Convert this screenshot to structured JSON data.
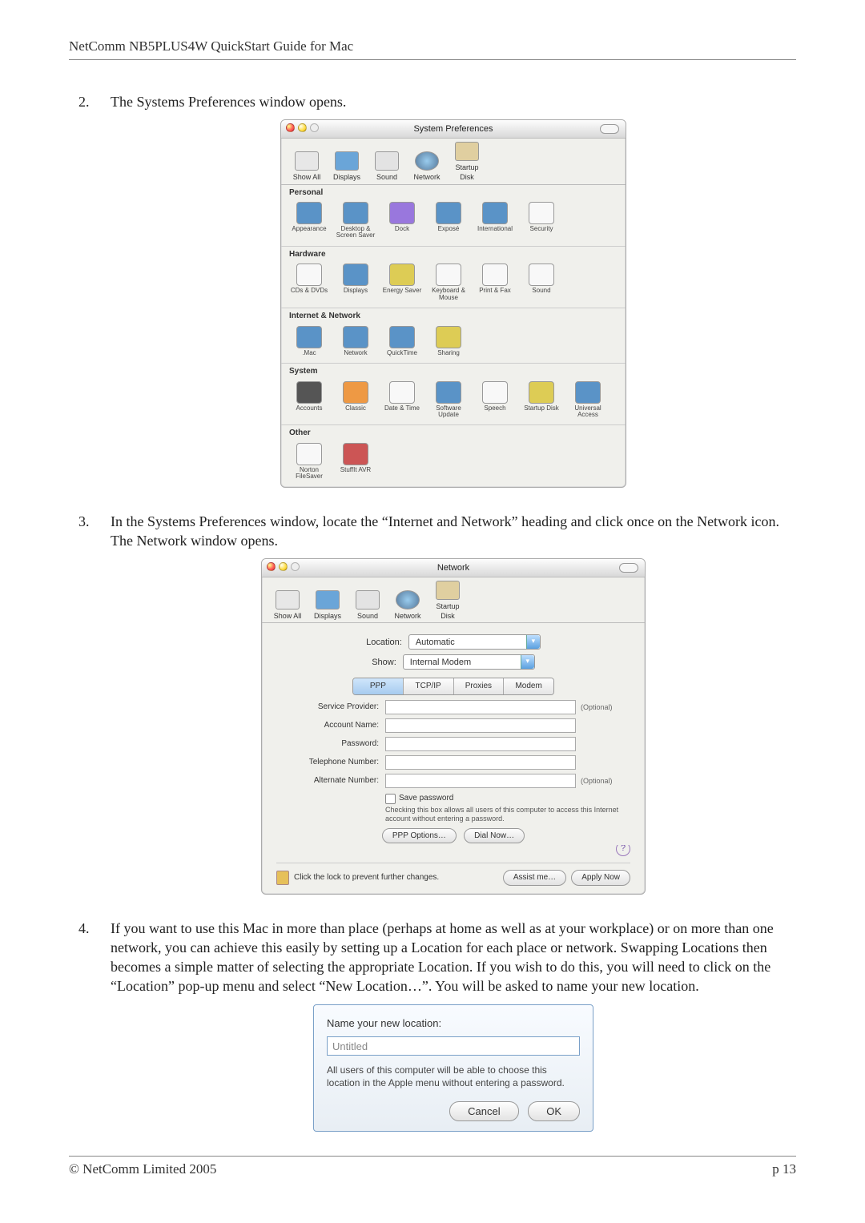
{
  "header": "NetComm NB5PLUS4W QuickStart Guide for Mac",
  "footer": {
    "left": "© NetComm Limited 2005",
    "right": "p 13"
  },
  "steps": {
    "s2": {
      "num": "2.",
      "text": "The Systems Preferences window opens."
    },
    "s3": {
      "num": "3.",
      "text": "In the Systems Preferences window, locate the “Internet and Network” heading and click once on the Network icon. The Network window opens."
    },
    "s4": {
      "num": "4.",
      "text": "If you want to use this Mac in more than place (perhaps at home as well as at your workplace) or on more than one network, you can achieve this easily by setting up a Location for each place or network. Swapping Locations then becomes a simple matter of selecting the appropriate Location. If you wish to do this, you will need to click on the “Location” pop-up menu and select “New Location…”. You will be asked to name your new location."
    }
  },
  "sysprefs": {
    "title": "System Preferences",
    "toolbar": [
      "Show All",
      "Displays",
      "Sound",
      "Network",
      "Startup Disk"
    ],
    "sections": [
      {
        "name": "Personal",
        "items": [
          "Appearance",
          "Desktop & Screen Saver",
          "Dock",
          "Exposé",
          "International",
          "Security"
        ]
      },
      {
        "name": "Hardware",
        "items": [
          "CDs & DVDs",
          "Displays",
          "Energy Saver",
          "Keyboard & Mouse",
          "Print & Fax",
          "Sound"
        ]
      },
      {
        "name": "Internet & Network",
        "items": [
          ".Mac",
          "Network",
          "QuickTime",
          "Sharing"
        ]
      },
      {
        "name": "System",
        "items": [
          "Accounts",
          "Classic",
          "Date & Time",
          "Software Update",
          "Speech",
          "Startup Disk",
          "Universal Access"
        ]
      },
      {
        "name": "Other",
        "items": [
          "Norton FileSaver",
          "StuffIt AVR"
        ]
      }
    ]
  },
  "network": {
    "title": "Network",
    "toolbar": [
      "Show All",
      "Displays",
      "Sound",
      "Network",
      "Startup Disk"
    ],
    "location_label": "Location:",
    "location_value": "Automatic",
    "show_label": "Show:",
    "show_value": "Internal Modem",
    "tabs": [
      "PPP",
      "TCP/IP",
      "Proxies",
      "Modem"
    ],
    "active_tab": "PPP",
    "fields": {
      "service_provider": "Service Provider:",
      "account_name": "Account Name:",
      "password": "Password:",
      "telephone": "Telephone Number:",
      "alternate": "Alternate Number:"
    },
    "optional": "(Optional)",
    "save_password": "Save password",
    "save_hint": "Checking this box allows all users of this computer to access this Internet account without entering a password.",
    "ppp_options_btn": "PPP Options…",
    "dial_now_btn": "Dial Now…",
    "help": "?",
    "lock_text": "Click the lock to prevent further changes.",
    "assist_btn": "Assist me…",
    "apply_btn": "Apply Now"
  },
  "name_dialog": {
    "prompt": "Name your new location:",
    "value": "Untitled",
    "hint": "All users of this computer will be able to choose this location in the Apple menu without entering a password.",
    "cancel": "Cancel",
    "ok": "OK"
  }
}
